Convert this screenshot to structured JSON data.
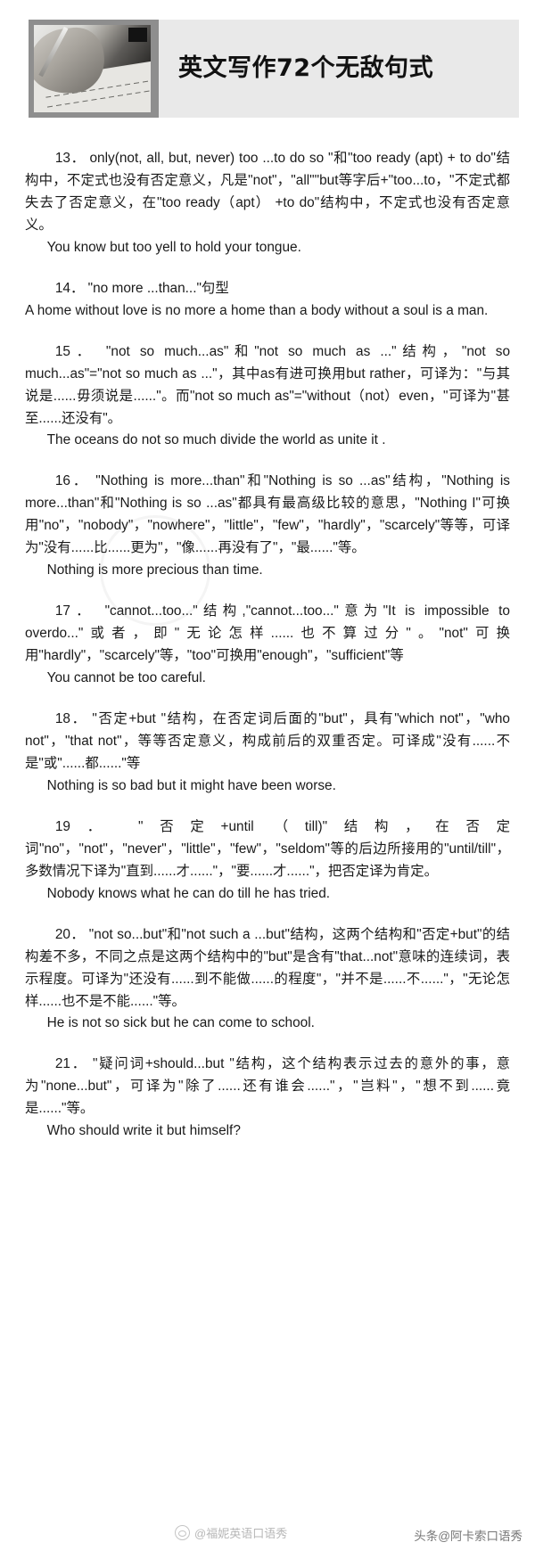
{
  "header": {
    "title": "英文写作72个无敌句式",
    "thumbnail_alt": "hand-writing-photo"
  },
  "entries": [
    {
      "number": "13",
      "explanation": "13．  only(not, all, but, never) too ...to do so \"和\"too ready (apt) + to do\"结构中，不定式也没有否定意义，凡是\"not\"，\"all\"\"but等字后+\"too...to，\"不定式都失去了否定意义，在\"too ready（apt） +to do\"结构中，不定式也没有否定意义。",
      "example": "You know but too yell to hold your tongue."
    },
    {
      "number": "14",
      "explanation": "14． \"no more ...than...\"句型",
      "example": "A home without love is no more a home than a body without a soul is a man."
    },
    {
      "number": "15",
      "explanation": "15． \"not so much...as\"和\"not so much as ...\"结构，\"not so much...as\"=\"not so much as ...\"，其中as有进可换用but rather，可译为：\"与其说是......毋须说是......\"。而\"not so much as\"=\"without（not）even，\"可译为\"甚至......还没有\"。",
      "example": "The oceans do not so much divide the world as unite it ."
    },
    {
      "number": "16",
      "explanation": "16． \"Nothing is more...than\"和\"Nothing is so ...as\"结构，\"Nothing is more...than\"和\"Nothing is so ...as\"都具有最高级比较的意思，\"Nothing I\"可换用\"no\"，\"nobody\"，\"nowhere\"，\"little\"，\"few\"，\"hardly\"，\"scarcely\"等等，可译为\"没有......比......更为\"，\"像......再没有了\"，\"最......\"等。",
      "example": "Nothing is more precious than time."
    },
    {
      "number": "17",
      "explanation": "17． \"cannot...too...\"结构,\"cannot...too...\"意为\"It is impossible to overdo...\"或者，即\"无论怎样......也不算过分\"。\"not\"可换用\"hardly\"，\"scarcely\"等，\"too\"可换用\"enough\"，\"sufficient\"等",
      "example": "You cannot be too careful."
    },
    {
      "number": "18",
      "explanation": "18． \"否定+but \"结构，在否定词后面的\"but\"，具有\"which not\"，\"who not\"，\"that not\"，等等否定意义，构成前后的双重否定。可译成\"没有......不是\"或\"......都......\"等",
      "example": "Nothing is so bad but it might have been worse."
    },
    {
      "number": "19",
      "explanation": "19． \"否定+until （till)\"结构，在否定词\"no\"，\"not\"，\"never\"，\"little\"，\"few\"，\"seldom\"等的后边所接用的\"until/till\"，多数情况下译为\"直到......才......\"，\"要......才......\"，把否定译为肯定。",
      "example": "Nobody knows what he can do till he has tried."
    },
    {
      "number": "20",
      "explanation": "20． \"not so...but\"和\"not such a ...but\"结构，这两个结构和\"否定+but\"的结构差不多，不同之点是这两个结构中的\"but\"是含有\"that...not\"意味的连续词，表示程度。可译为\"还没有......到不能做......的程度\"，\"并不是......不......\"，\"无论怎样......也不是不能......\"等。",
      "example": "He is not so sick but he can come to school."
    },
    {
      "number": "21",
      "explanation": "21． \"疑问词+should...but \"结构，这个结构表示过去的意外的事，意为\"none...but\"，可译为\"除了......还有谁会......\"，\"岂料\"，\"想不到......竟是......\"等。",
      "example": "Who should write it but himself?"
    }
  ],
  "watermarks": {
    "center": "@福妮英语口语秀",
    "right": "头条@阿卡索口语秀"
  }
}
